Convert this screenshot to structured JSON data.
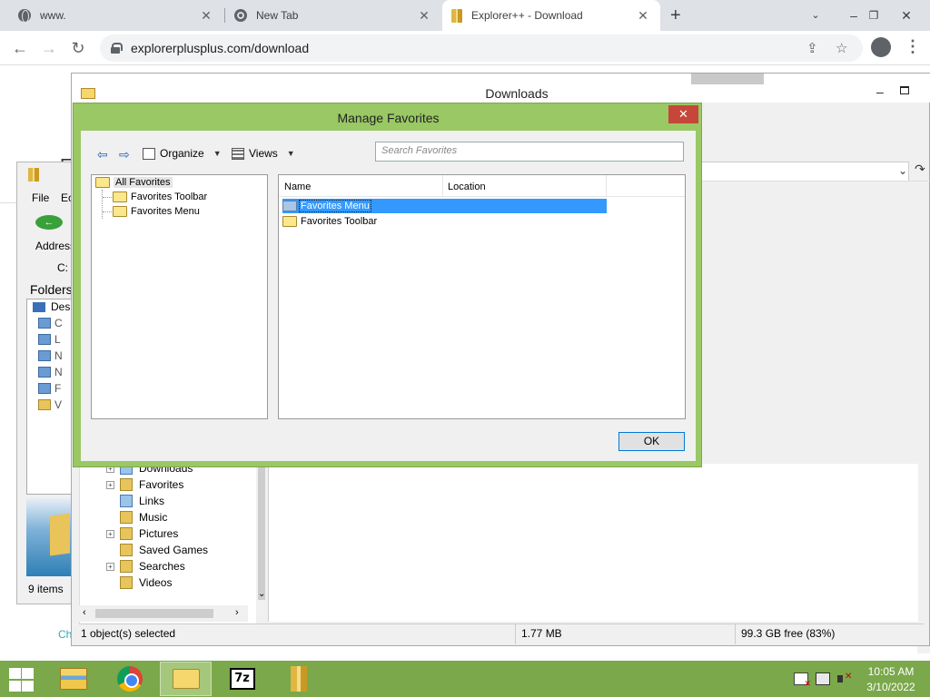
{
  "browser": {
    "tabs": [
      {
        "label": "www."
      },
      {
        "label": "New Tab"
      },
      {
        "label": "Explorer++ - Download"
      }
    ],
    "url": "explorerplusplus.com/download"
  },
  "webpage": {
    "letter_e": "E",
    "letter_d": "D",
    "link_fragment": "Ch"
  },
  "left_window": {
    "menu_file": "File",
    "menu_edit": "Ec",
    "address_label": "Address",
    "drive": "C:",
    "folders_label": "Folders",
    "tree_first": "Desk",
    "tree_rows": [
      "C",
      "L",
      "N",
      "N",
      "F",
      "V"
    ],
    "items_count": "9 items"
  },
  "downloads_window": {
    "title": "Downloads",
    "tree_items": [
      {
        "label": "Downloads",
        "expandable": true
      },
      {
        "label": "Favorites",
        "expandable": true
      },
      {
        "label": "Links",
        "expandable": false
      },
      {
        "label": "Music",
        "expandable": false
      },
      {
        "label": "Pictures",
        "expandable": true
      },
      {
        "label": "Saved Games",
        "expandable": false
      },
      {
        "label": "Searches",
        "expandable": true
      },
      {
        "label": "Videos",
        "expandable": false
      }
    ],
    "status": {
      "selection": "1 object(s) selected",
      "size": "1.77 MB",
      "free": "99.3 GB free (83%)"
    }
  },
  "manage_favorites": {
    "title": "Manage Favorites",
    "close_glyph": "✕",
    "toolbar": {
      "organize": "Organize",
      "views": "Views",
      "search_placeholder": "Search Favorites"
    },
    "tree": [
      {
        "label": "All Favorites"
      },
      {
        "label": "Favorites Toolbar"
      },
      {
        "label": "Favorites Menu"
      }
    ],
    "columns": {
      "name": "Name",
      "location": "Location"
    },
    "rows": [
      {
        "name": "Favorites Menu",
        "selected": true
      },
      {
        "name": "Favorites Toolbar",
        "selected": false
      }
    ],
    "ok": "OK"
  },
  "taskbar": {
    "seven_zip": "7z",
    "time": "10:05 AM",
    "date": "3/10/2022"
  }
}
